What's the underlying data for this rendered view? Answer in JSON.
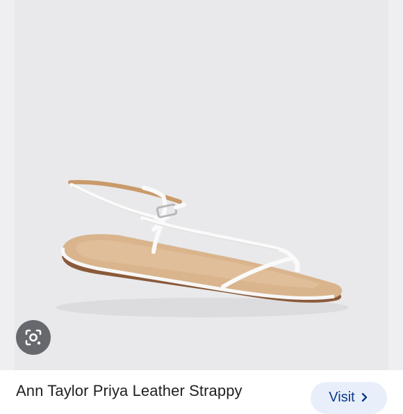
{
  "product": {
    "title": "Ann Taylor Priya Leather Strappy"
  },
  "actions": {
    "visit_label": "Visit"
  },
  "icons": {
    "lens": "google-lens-icon",
    "visit": "chevron-right-icon"
  },
  "colors": {
    "photo_background": "#e9e9eb",
    "visit_button_bg": "#e8effb",
    "visit_text": "#0b3a86",
    "lens_button_bg": "#5b5e63"
  }
}
